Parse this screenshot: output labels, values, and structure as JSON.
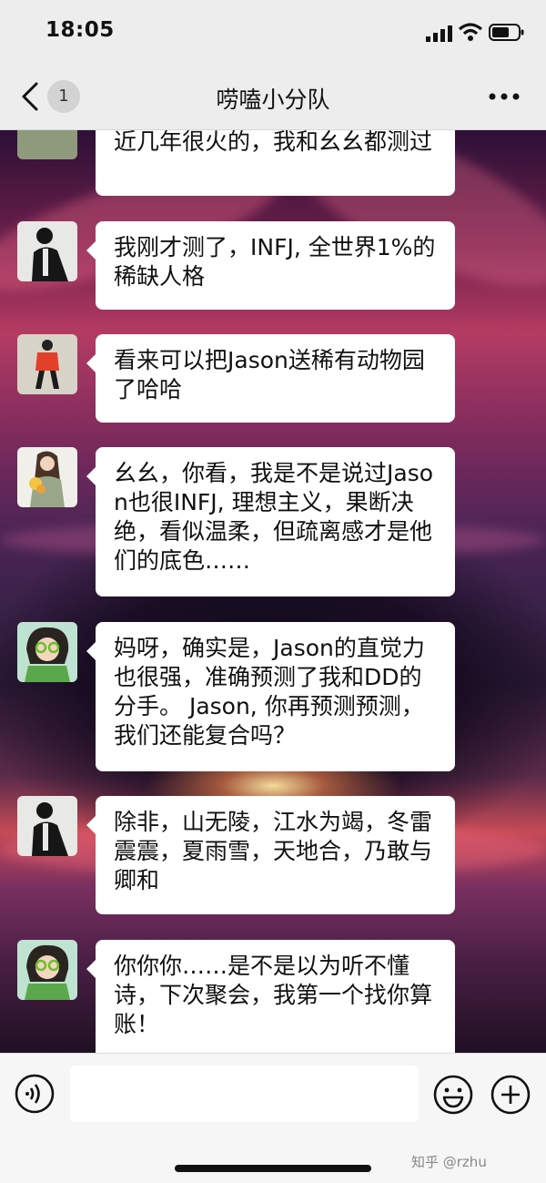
{
  "status": {
    "time": "18:05"
  },
  "nav": {
    "back_badge": "1",
    "title": "唠嗑小分队"
  },
  "messages": [
    {
      "text": "近几年很火的，我和幺幺都测过"
    },
    {
      "text": "我刚才测了，INFJ, 全世界1%的稀缺人格"
    },
    {
      "text": "看来可以把Jason送稀有动物园了哈哈"
    },
    {
      "text": "幺幺，你看，我是不是说过Jason也很INFJ, 理想主义，果断决绝，看似温柔，但疏离感才是他们的底色……"
    },
    {
      "text": "妈呀，确实是，Jason的直觉力也很强，准确预测了我和DD的分手。 Jason, 你再预测预测，我们还能复合吗？"
    },
    {
      "text": "除非，山无陵，江水为竭，冬雷震震，夏雨雪，天地合，乃敢与卿和"
    },
    {
      "text": "你你你……是不是以为听不懂诗，下次聚会，我第一个找你算账！"
    }
  ],
  "input": {
    "placeholder": ""
  },
  "watermark": {
    "text": "知乎 @rzhu"
  },
  "colors": {
    "bubble": "#ffffff",
    "bar": "#ededed"
  }
}
